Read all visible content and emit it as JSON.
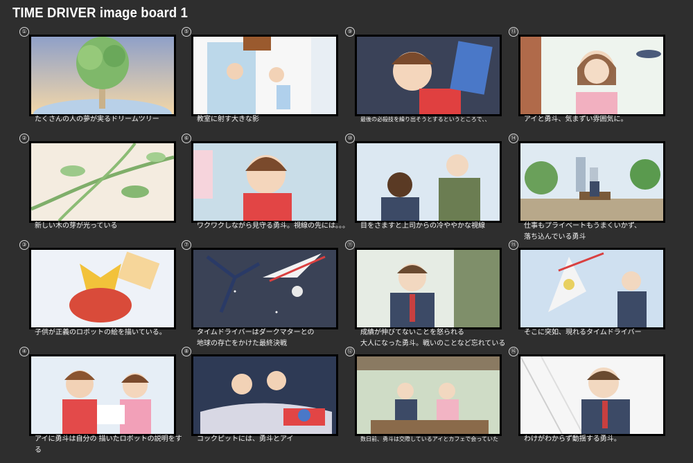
{
  "title": "TIME DRIVER  image board 1",
  "panels": [
    {
      "num": "①",
      "caption": "たくさんの人の夢が実るドリームツリー"
    },
    {
      "num": "②",
      "caption": "新しい木の芽が光っている"
    },
    {
      "num": "③",
      "caption": "子供が正義のロボットの絵を描いている。"
    },
    {
      "num": "④",
      "caption": "アイに勇斗は自分の 描いたロボットの説明をする"
    },
    {
      "num": "⑤",
      "caption": "教室に射す大きな影"
    },
    {
      "num": "⑥",
      "caption": "ワクワクしながら見守る勇斗。視線の先には。。。"
    },
    {
      "num": "⑦",
      "caption": "タイムドライバーはダークマターとの\n地球の存亡をかけた最終決戦"
    },
    {
      "num": "⑧",
      "caption": "コックピットには、勇斗とアイ"
    },
    {
      "num": "⑨",
      "caption": "最後の必殺技を繰り出そうとするというところで、、"
    },
    {
      "num": "⑩",
      "caption": "目をさますと上司からの冷ややかな視線"
    },
    {
      "num": "⑪",
      "caption": "成績が伸びてないことを怒られる\n大人になった勇斗。戦いのことなど忘れている"
    },
    {
      "num": "⑫",
      "caption": "数日前、勇斗は交際しているアイとカフェで会っていた"
    },
    {
      "num": "⑬",
      "caption": "アイと勇斗、気まずい雰囲気に。"
    },
    {
      "num": "⑭",
      "caption": "仕事もプライベートもうまくいかず、\n落ち込んでいる勇斗"
    },
    {
      "num": "⑮",
      "caption": "そこに突如、現れるタイムドライバー"
    },
    {
      "num": "⑯",
      "caption": "わけがわからず動揺する勇斗。"
    }
  ]
}
